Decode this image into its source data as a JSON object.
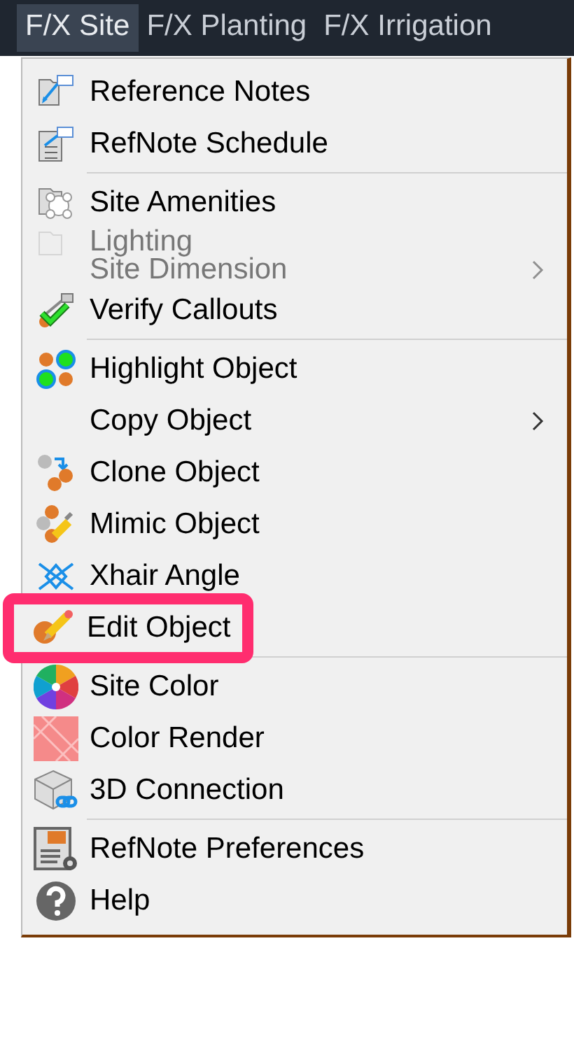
{
  "menubar": [
    {
      "label": "F/X Site",
      "selected": true
    },
    {
      "label": "F/X Planting",
      "selected": false
    },
    {
      "label": "F/X Irrigation",
      "selected": false
    }
  ],
  "menu": {
    "sections": [
      [
        {
          "label": "Reference Notes",
          "faded": false,
          "submenu": false,
          "highlighted": false
        },
        {
          "label": "RefNote Schedule",
          "faded": false,
          "submenu": false,
          "highlighted": false
        }
      ],
      [
        {
          "label": "Site Amenities",
          "faded": false,
          "submenu": false,
          "highlighted": false
        },
        {
          "label": "Lighting",
          "faded": true,
          "submenu": false,
          "highlighted": false
        },
        {
          "label": "Site Dimension",
          "faded": true,
          "submenu": true,
          "highlighted": false
        },
        {
          "label": "Verify Callouts",
          "faded": false,
          "submenu": false,
          "highlighted": false
        }
      ],
      [
        {
          "label": "Highlight Object",
          "faded": false,
          "submenu": false,
          "highlighted": false
        },
        {
          "label": "Copy Object",
          "faded": false,
          "submenu": true,
          "highlighted": false
        },
        {
          "label": "Clone Object",
          "faded": false,
          "submenu": false,
          "highlighted": false
        },
        {
          "label": "Mimic Object",
          "faded": false,
          "submenu": false,
          "highlighted": false
        },
        {
          "label": "Xhair Angle",
          "faded": false,
          "submenu": false,
          "highlighted": false
        },
        {
          "label": "Edit Object",
          "faded": false,
          "submenu": false,
          "highlighted": true
        }
      ],
      [
        {
          "label": "Site Color",
          "faded": false,
          "submenu": false,
          "highlighted": false
        },
        {
          "label": "Color Render",
          "faded": false,
          "submenu": false,
          "highlighted": false
        },
        {
          "label": "3D Connection",
          "faded": false,
          "submenu": false,
          "highlighted": false
        }
      ],
      [
        {
          "label": "RefNote Preferences",
          "faded": false,
          "submenu": false,
          "highlighted": false
        },
        {
          "label": "Help",
          "faded": false,
          "submenu": false,
          "highlighted": false
        }
      ]
    ]
  }
}
